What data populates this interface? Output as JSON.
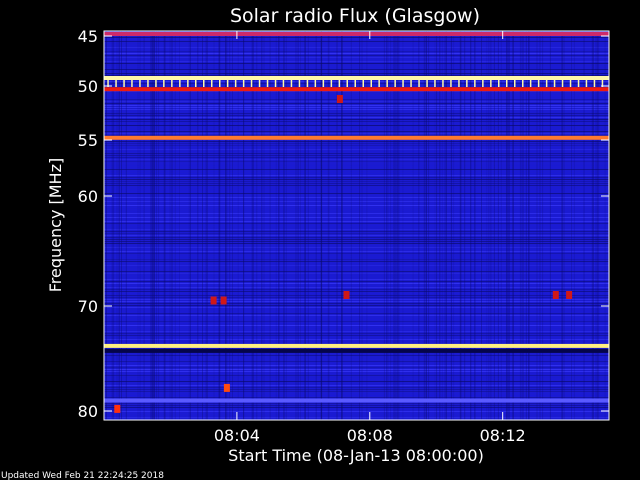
{
  "chart_data": {
    "type": "heatmap",
    "title": "Solar radio Flux (Glasgow)",
    "xlabel": "Start Time (08-Jan-13 08:00:00)",
    "ylabel": "Frequency [MHz]",
    "x_unit": "minutes after 08:00:00",
    "xlim": [
      0,
      15.2
    ],
    "ylim_mhz": [
      44.5,
      80.5
    ],
    "y_scale": "nonlinear (frequency increases downward)",
    "x_ticks": [
      {
        "minute": 4,
        "label": "08:04"
      },
      {
        "minute": 8,
        "label": "08:08"
      },
      {
        "minute": 12,
        "label": "08:12"
      }
    ],
    "y_ticks": [
      {
        "mhz": 45,
        "label": "45"
      },
      {
        "mhz": 50,
        "label": "50"
      },
      {
        "mhz": 55,
        "label": "55"
      },
      {
        "mhz": 60,
        "label": "60"
      },
      {
        "mhz": 70,
        "label": "70"
      },
      {
        "mhz": 80,
        "label": "80"
      }
    ],
    "colormap": [
      "#0a0a6e",
      "#1a1ad8",
      "#3d3dff",
      "#d01818",
      "#ff6a2a",
      "#ffd04a",
      "#ffffa0"
    ],
    "background_color": "#1b1bd0",
    "horizontal_bands": [
      {
        "mhz": 44.8,
        "color": "#cc2a6a"
      },
      {
        "mhz": 49.2,
        "color": "#fff7a8"
      },
      {
        "mhz": 50.3,
        "color": "#ee1a10"
      },
      {
        "mhz": 54.8,
        "color": "#ff7a2e"
      },
      {
        "mhz": 73.8,
        "color": "#fff080"
      },
      {
        "mhz": 79.0,
        "color": "#5a5aff"
      }
    ],
    "hot_spots": [
      {
        "minute": 7.1,
        "mhz": 51.2,
        "color": "#d01818"
      },
      {
        "minute": 3.7,
        "mhz": 77.8,
        "color": "#ff4a10"
      },
      {
        "minute": 0.4,
        "mhz": 79.8,
        "color": "#ff3010"
      },
      {
        "minute": 3.3,
        "mhz": 69.5,
        "color": "#d01818"
      },
      {
        "minute": 3.6,
        "mhz": 69.5,
        "color": "#d01818"
      },
      {
        "minute": 13.6,
        "mhz": 69.0,
        "color": "#d01818"
      },
      {
        "minute": 14.0,
        "mhz": 69.0,
        "color": "#d01818"
      },
      {
        "minute": 7.3,
        "mhz": 69.0,
        "color": "#d01818"
      }
    ],
    "footer": "Updated Wed Feb 21 22:24:25 2018"
  }
}
